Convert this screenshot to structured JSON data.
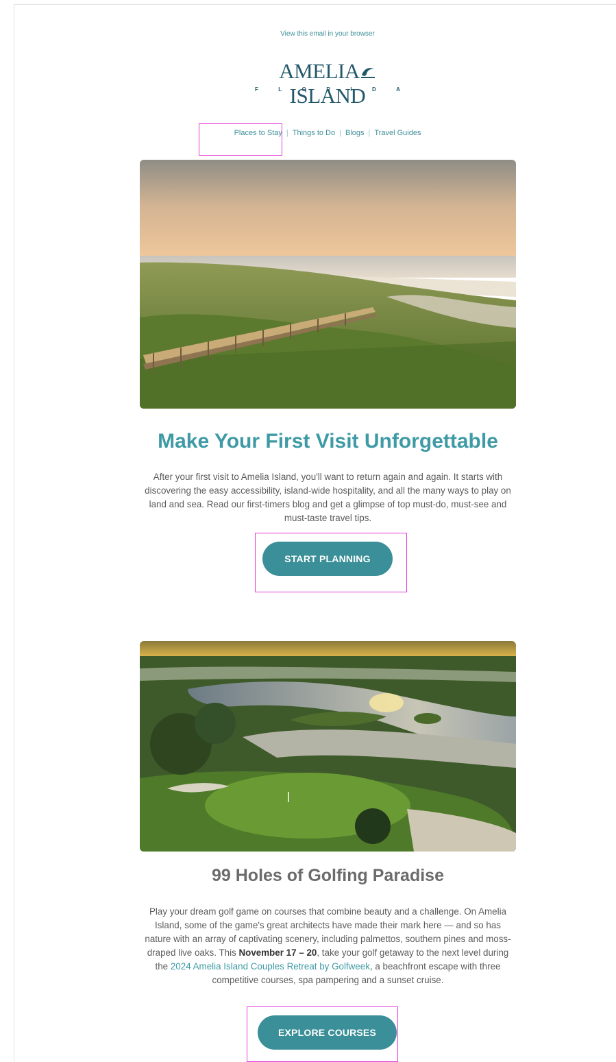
{
  "email": {
    "view_in_browser": "View this email in your browser",
    "logo": {
      "name_first": "AMELIA",
      "name_second": "ISLAND",
      "subtitle_letters": [
        "F",
        "L",
        "O",
        "R",
        "I",
        "D",
        "A"
      ]
    },
    "nav": [
      {
        "label": "Places to Stay"
      },
      {
        "label": "Things to Do"
      },
      {
        "label": "Blogs"
      },
      {
        "label": "Travel Guides"
      }
    ],
    "nav_separator": "|",
    "section1": {
      "image_icon": "beach-boardwalk-photo",
      "title": "Make Your First Visit Unforgettable",
      "body": "After your first visit to Amelia Island, you'll want to return again and again. It starts with discovering the easy accessibility, island-wide hospitality, and all the many ways to play on land and sea. Read our first-timers blog and get a glimpse of top must-do, must-see and must-taste travel tips.",
      "button": "START PLANNING"
    },
    "section2": {
      "image_icon": "golf-course-marsh-photo",
      "title": "99 Holes of Golfing Paradise",
      "body_before": "Play your dream golf game on courses that combine beauty and a challenge. On Amelia Island, some of the game's great architects have made their mark here — and so has nature with an array of captivating scenery, including palmettos, southern pines and moss-draped live oaks. This ",
      "body_bold": "November 17 – 20",
      "body_middle": ", take your golf getaway to the next level during the ",
      "body_link": "2024 Amelia Island Couples Retreat by Golfweek",
      "body_after": ", a beachfront escape with three competitive courses, spa pampering and a sunset cruise.",
      "button": "EXPLORE COURSES"
    },
    "colors": {
      "accent": "#3e9aa5",
      "button": "#3b8f98",
      "logo": "#24596b",
      "highlight": "#e33ad8"
    }
  }
}
